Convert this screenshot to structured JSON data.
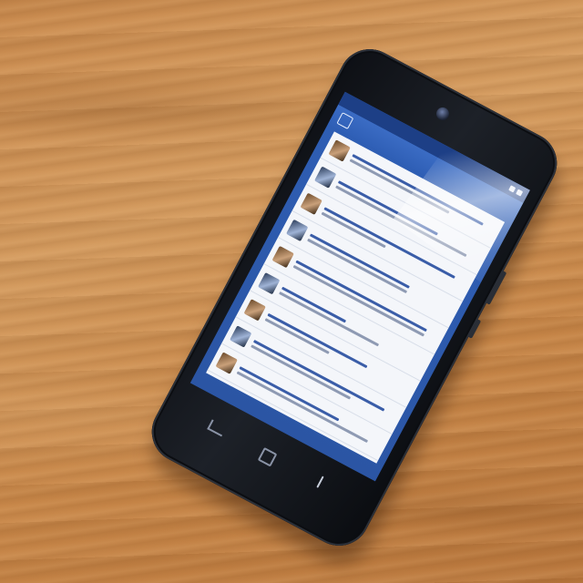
{
  "scene": {
    "subject": "smartphone",
    "surface": "wooden-table"
  },
  "phone": {
    "app_feed_rows": 9,
    "colors": {
      "body": "#0d0f14",
      "screen_accent": "#2f5fb6",
      "feed_background": "#f4f6fa",
      "wood": "#c98a4e"
    }
  },
  "icons": {
    "camera": "front-camera-icon",
    "back": "back-key-icon",
    "home": "home-key-icon",
    "menu": "menu-key-icon"
  }
}
